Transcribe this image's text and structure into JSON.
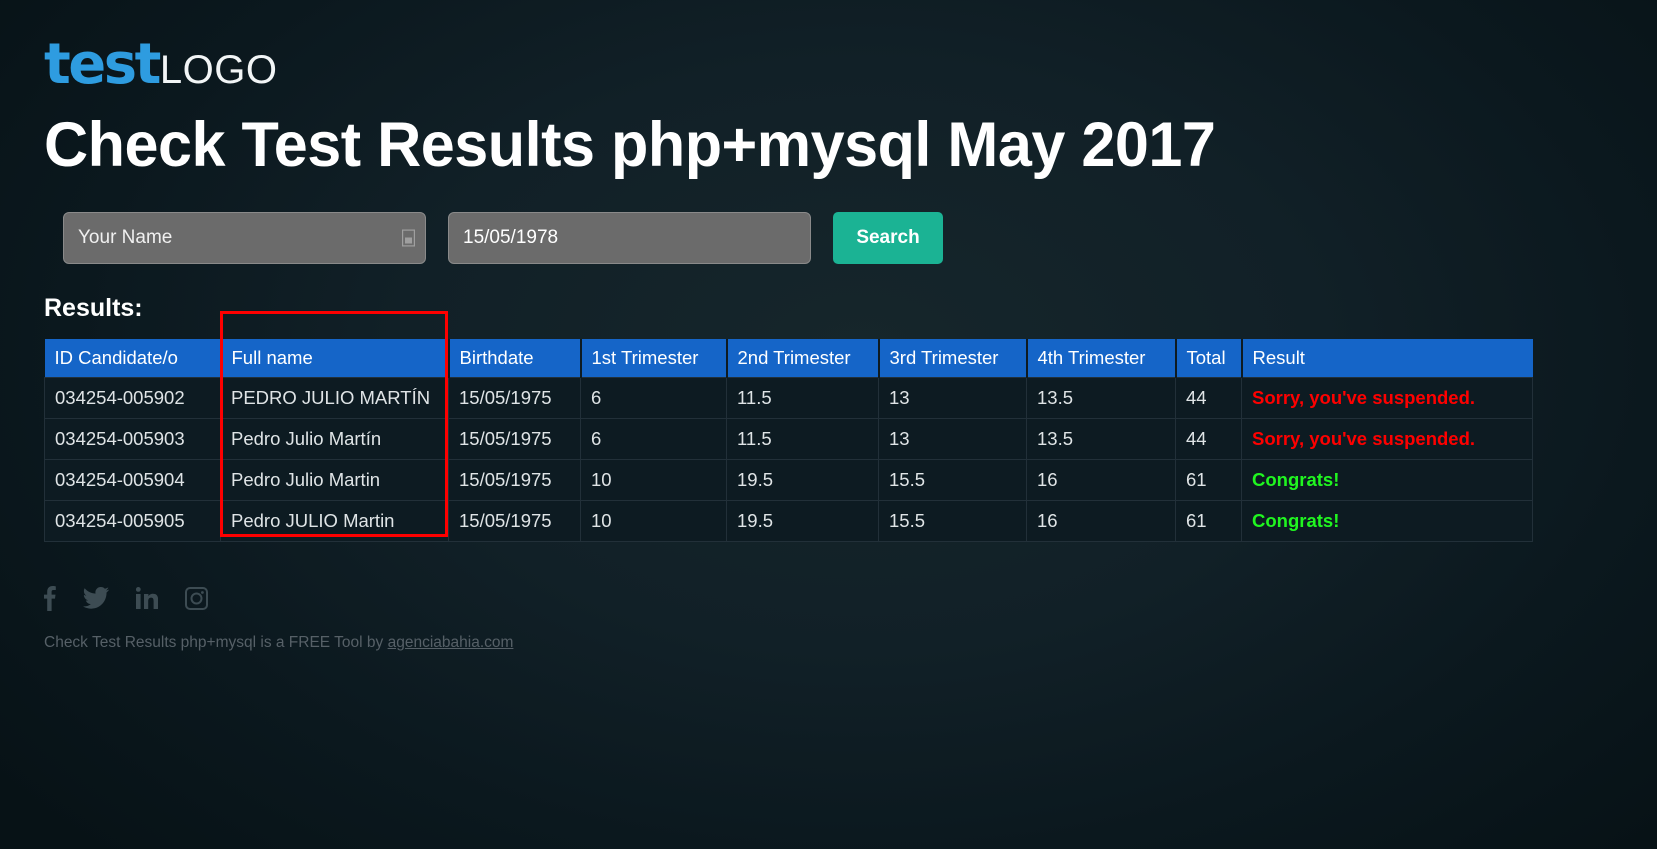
{
  "brand": {
    "logo_primary": "test",
    "logo_secondary": "LOGO"
  },
  "header": {
    "title": "Check Test Results php+mysql May 2017"
  },
  "search": {
    "name_value": "",
    "name_placeholder": "Your Name",
    "date_value": "15/05/1978",
    "date_placeholder": "",
    "button_label": "Search"
  },
  "results": {
    "label": "Results:",
    "columns": [
      "ID Candidate/o",
      "Full name",
      "Birthdate",
      "1st Trimester",
      "2nd Trimester",
      "3rd Trimester",
      "4th Trimester",
      "Total",
      "Result"
    ],
    "rows": [
      {
        "id": "034254-005902",
        "full_name": "PEDRO JULIO MARTÍN",
        "birthdate": "15/05/1975",
        "t1": "6",
        "t2": "11.5",
        "t3": "13",
        "t4": "13.5",
        "total": "44",
        "result": "Sorry, you've suspended.",
        "result_state": "fail"
      },
      {
        "id": "034254-005903",
        "full_name": "Pedro Julio Martín",
        "birthdate": "15/05/1975",
        "t1": "6",
        "t2": "11.5",
        "t3": "13",
        "t4": "13.5",
        "total": "44",
        "result": "Sorry, you've suspended.",
        "result_state": "fail"
      },
      {
        "id": "034254-005904",
        "full_name": "Pedro Julio Martin",
        "birthdate": "15/05/1975",
        "t1": "10",
        "t2": "19.5",
        "t3": "15.5",
        "t4": "16",
        "total": "61",
        "result": "Congrats!",
        "result_state": "pass"
      },
      {
        "id": "034254-005905",
        "full_name": "Pedro JULIO Martin",
        "birthdate": "15/05/1975",
        "t1": "10",
        "t2": "19.5",
        "t3": "15.5",
        "t4": "16",
        "total": "61",
        "result": "Congrats!",
        "result_state": "pass"
      }
    ]
  },
  "footer": {
    "social": [
      "facebook-icon",
      "twitter-icon",
      "linkedin-icon",
      "instagram-icon"
    ],
    "text_before": "Check Test Results php+mysql is a FREE Tool by ",
    "link_label": "agenciabahia.com"
  },
  "colors": {
    "accent_blue": "#1565c8",
    "logo_blue": "#2e9ce0",
    "search_green": "#1bb394",
    "fail_red": "#fe0000",
    "pass_green": "#20f520",
    "highlight_red": "#fe0000"
  }
}
